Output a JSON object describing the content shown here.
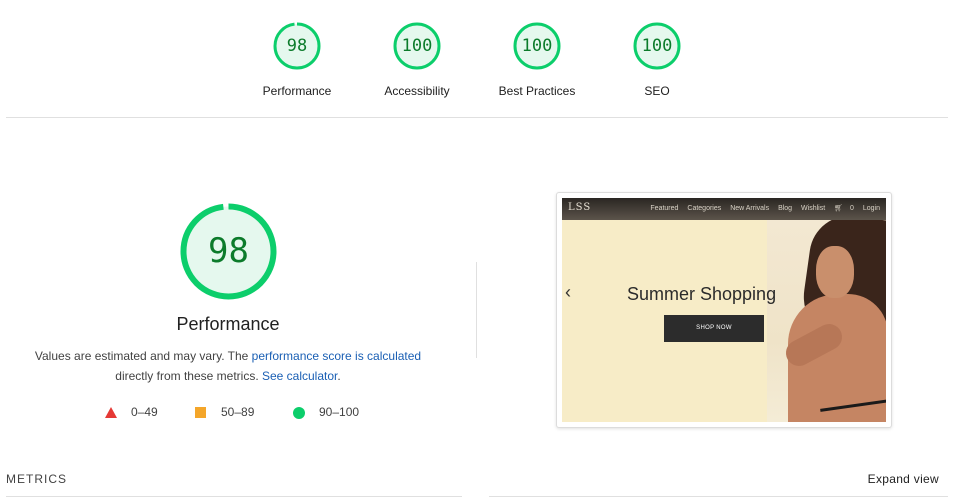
{
  "summary_gauges": [
    {
      "score": "98",
      "label": "Performance",
      "fraction": 0.98
    },
    {
      "score": "100",
      "label": "Accessibility",
      "fraction": 1.0
    },
    {
      "score": "100",
      "label": "Best Practices",
      "fraction": 1.0
    },
    {
      "score": "100",
      "label": "SEO",
      "fraction": 1.0
    }
  ],
  "performance": {
    "score": "98",
    "fraction": 0.98,
    "title": "Performance",
    "desc_prefix": "Values are estimated and may vary. The ",
    "desc_link": "performance score is calculated",
    "desc_middle": "directly from these metrics. ",
    "calc_link": "See calculator",
    "desc_suffix": "."
  },
  "legend": [
    {
      "icon": "triangle-icon",
      "label": "0–49",
      "color": "#e53935"
    },
    {
      "icon": "square-icon",
      "label": "50–89",
      "color": "#f4a62a"
    },
    {
      "icon": "circle-icon",
      "label": "90–100",
      "color": "#0cce6b"
    }
  ],
  "screenshot": {
    "logo": "LSS",
    "nav": [
      "Featured",
      "Categories",
      "New Arrivals",
      "Blog",
      "Wishlist",
      "0",
      "Login"
    ],
    "headline": "Summer Shopping",
    "cta": "SHOP NOW",
    "prev_arrow": "‹"
  },
  "metrics_heading": "METRICS",
  "expand_label": "Expand view",
  "colors": {
    "pass": "#0cce6b",
    "pass_text": "#0c7b2b",
    "pass_fill": "#e5f8ee"
  }
}
